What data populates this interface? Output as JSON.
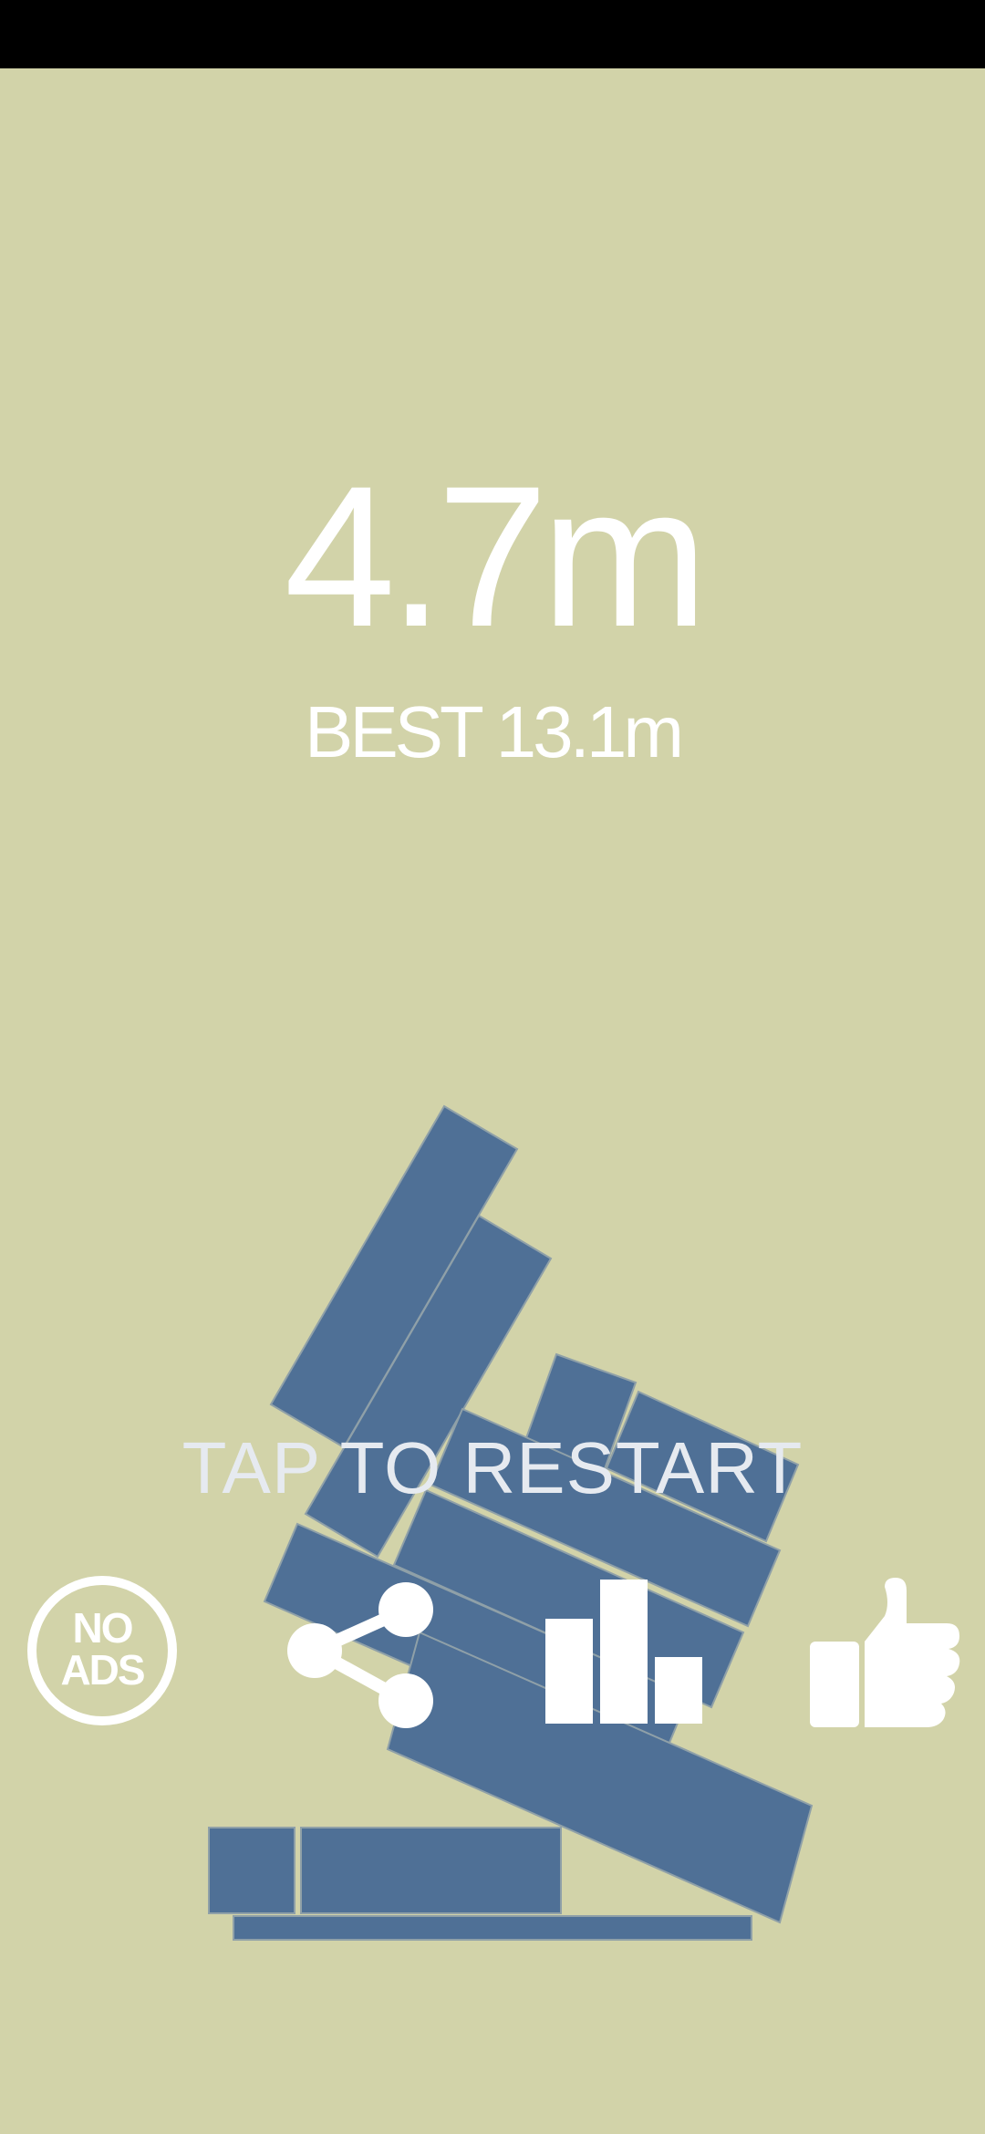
{
  "score": "4.7m",
  "best": "BEST 13.1m",
  "tap_prompt": "TAP TO RESTART",
  "no_ads_label": {
    "line1": "NO",
    "line2": "ADS"
  },
  "icons": {
    "no_ads": "no-ads-icon",
    "share": "share-icon",
    "leaderboard": "leaderboard-icon",
    "like": "thumbs-up-icon"
  },
  "colors": {
    "background": "#D2D3A9",
    "status_bar": "#000000",
    "block": "#4F7096",
    "text": "#FFFFFF",
    "tap_text": "#E6EAF0"
  }
}
